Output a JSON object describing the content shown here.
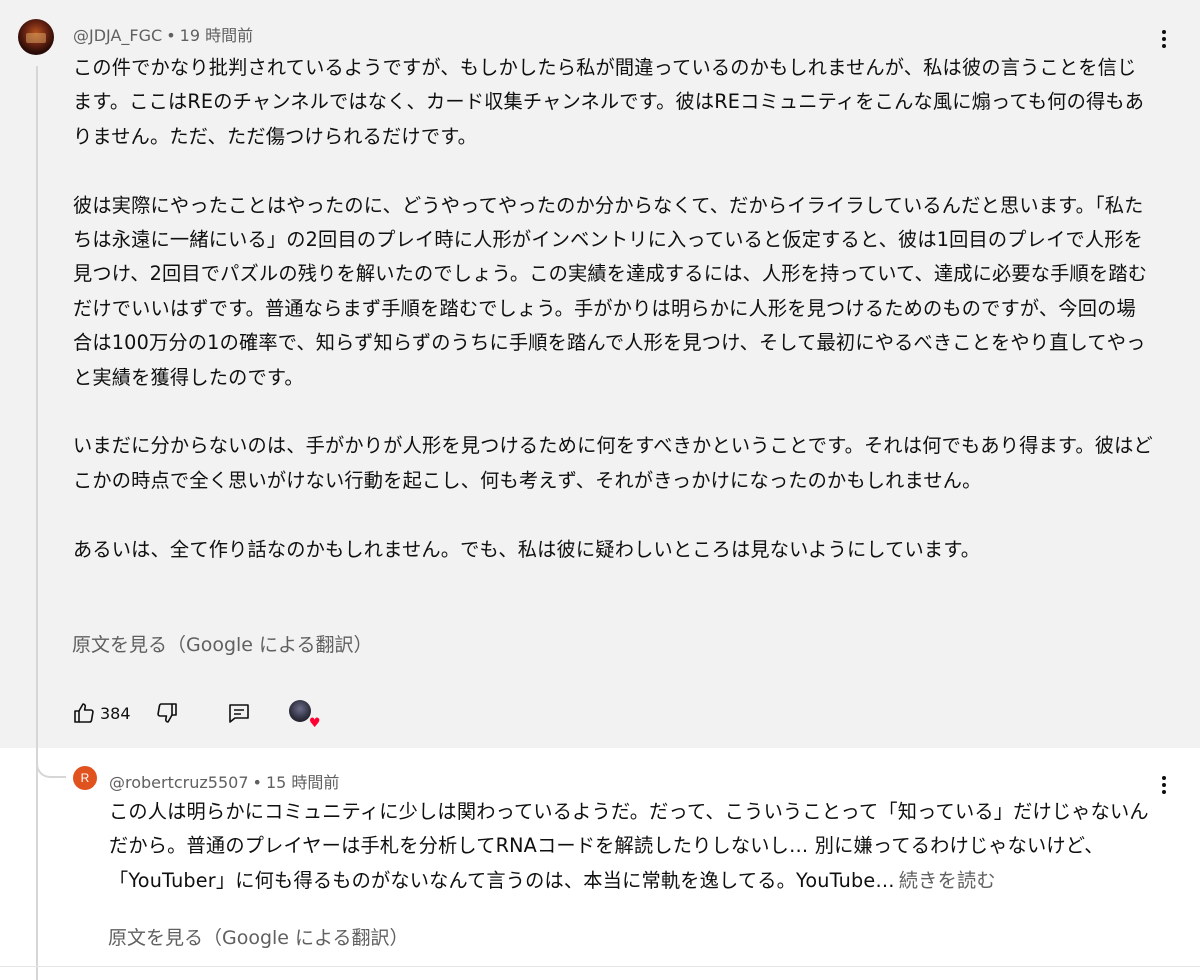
{
  "main_comment": {
    "handle": "@JDJA_FGC",
    "separator": "•",
    "time": "19 時間前",
    "paragraphs": [
      "この件でかなり批判されているようですが、もしかしたら私が間違っているのかもしれませんが、私は彼の言うことを信じます。ここはREのチャンネルではなく、カード収集チャンネルです。彼はREコミュニティをこんな風に煽っても何の得もありません。ただ、ただ傷つけられるだけです。",
      "彼は実際にやったことはやったのに、どうやってやったのか分からなくて、だからイライラしているんだと思います。「私たちは永遠に一緒にいる」の2回目のプレイ時に人形がインベントリに入っていると仮定すると、彼は1回目のプレイで人形を見つけ、2回目でパズルの残りを解いたのでしょう。この実績を達成するには、人形を持っていて、達成に必要な手順を踏むだけでいいはずです。普通ならまず手順を踏むでしょう。手がかりは明らかに人形を見つけるためのものですが、今回の場合は100万分の1の確率で、知らず知らずのうちに手順を踏んで人形を見つけ、そして最初にやるべきことをやり直してやっと実績を獲得したのです。",
      "いまだに分からないのは、手がかりが人形を見つけるために何をすべきかということです。それは何でもあり得ます。彼はどこかの時点で全く思いがけない行動を起こし、何も考えず、それがきっかけになったのかもしれません。",
      "あるいは、全て作り話なのかもしれません。でも、私は彼に疑わしいところは見ないようにしています。"
    ],
    "translate_link": "原文を見る（Google による翻訳）",
    "like_count": "384",
    "icons": {
      "like": "thumbs-up-icon",
      "dislike": "thumbs-down-icon",
      "reply": "reply-comment-icon",
      "creator_heart": "creator-heart-icon",
      "menu": "more-vert-icon"
    }
  },
  "reply": {
    "avatar_letter": "R",
    "avatar_color": "#e0531f",
    "handle": "@robertcruz5507",
    "separator": "•",
    "time": "15 時間前",
    "text": "この人は明らかにコミュニティに少しは関わっているようだ。だって、こういうことって「知っている」だけじゃないんだから。普通のプレイヤーは手札を分析してRNAコードを解読したりしないし… 別に嫌ってるわけじゃないけど、「YouTuber」に何も得るものがないなんて言うのは、本当に常軌を逸してる。YouTube…",
    "read_more": "続きを読む",
    "translate_link": "原文を見る（Google による翻訳）"
  },
  "colors": {
    "highlight_bg": "#f2f2f2",
    "secondary_text": "#606060",
    "primary_text": "#0f0f0f",
    "heart": "#ff0033"
  }
}
